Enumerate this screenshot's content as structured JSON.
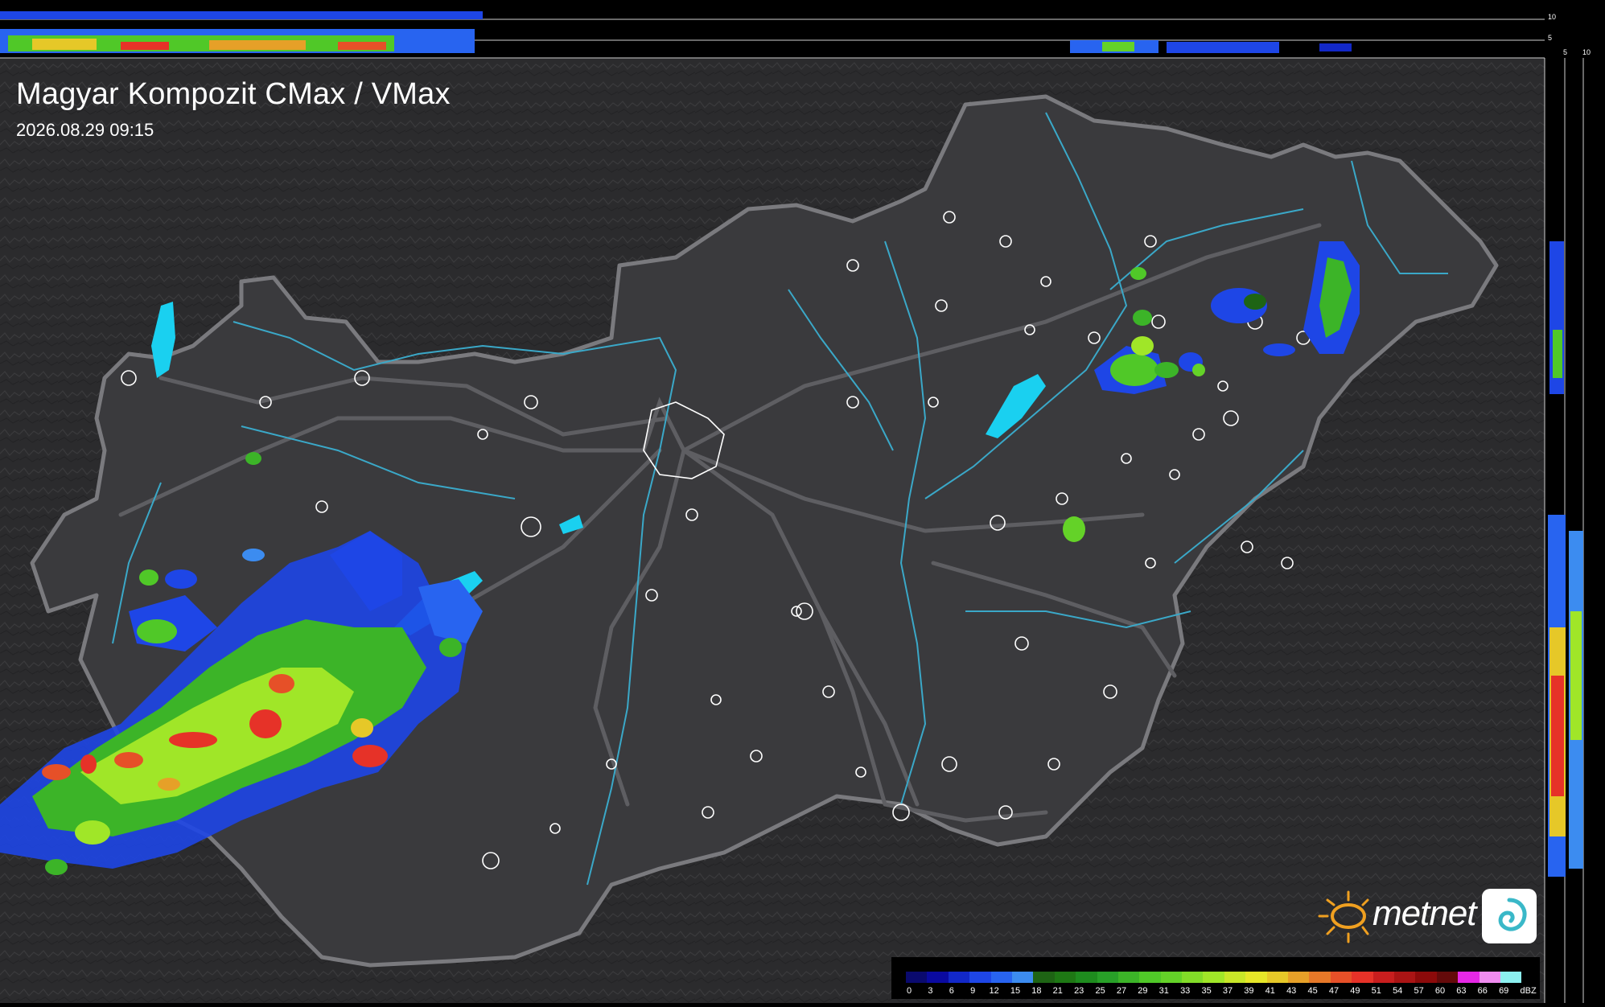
{
  "header": {
    "title": "Magyar Kompozit CMax / VMax",
    "timestamp": "2026.08.29 09:15"
  },
  "top_profile_scale": [
    "10",
    "5"
  ],
  "side_profile_scale": [
    "5",
    "10"
  ],
  "legend": {
    "unit": "dBZ",
    "values": [
      "0",
      "3",
      "6",
      "9",
      "12",
      "15",
      "18",
      "21",
      "23",
      "25",
      "27",
      "29",
      "31",
      "33",
      "35",
      "37",
      "39",
      "41",
      "43",
      "45",
      "47",
      "49",
      "51",
      "54",
      "57",
      "60",
      "63",
      "66",
      "69"
    ],
    "colors": [
      "#0a0a6e",
      "#0a0aa0",
      "#1228c8",
      "#1e46e6",
      "#2864f0",
      "#3c8cf0",
      "#1e6414",
      "#1e7814",
      "#1e8c1e",
      "#28a028",
      "#3cb428",
      "#50c828",
      "#64d228",
      "#82dc28",
      "#a0e628",
      "#c8e628",
      "#e6e628",
      "#e6c828",
      "#e6a028",
      "#e67828",
      "#e65028",
      "#e63228",
      "#c81e1e",
      "#aa1414",
      "#8c0a0a",
      "#640a0a",
      "#e628e6",
      "#f08cf0",
      "#8cf0f0"
    ]
  },
  "brand": {
    "name": "metnet"
  },
  "colors": {
    "background": "#2c2c2e",
    "hungary_fill": "#3a3a3d",
    "border": "#7a7a7e",
    "river": "#3aa8c8",
    "lake": "#1ad0f0",
    "city_outline": "#ffffff",
    "road": "#5a5a5e"
  }
}
